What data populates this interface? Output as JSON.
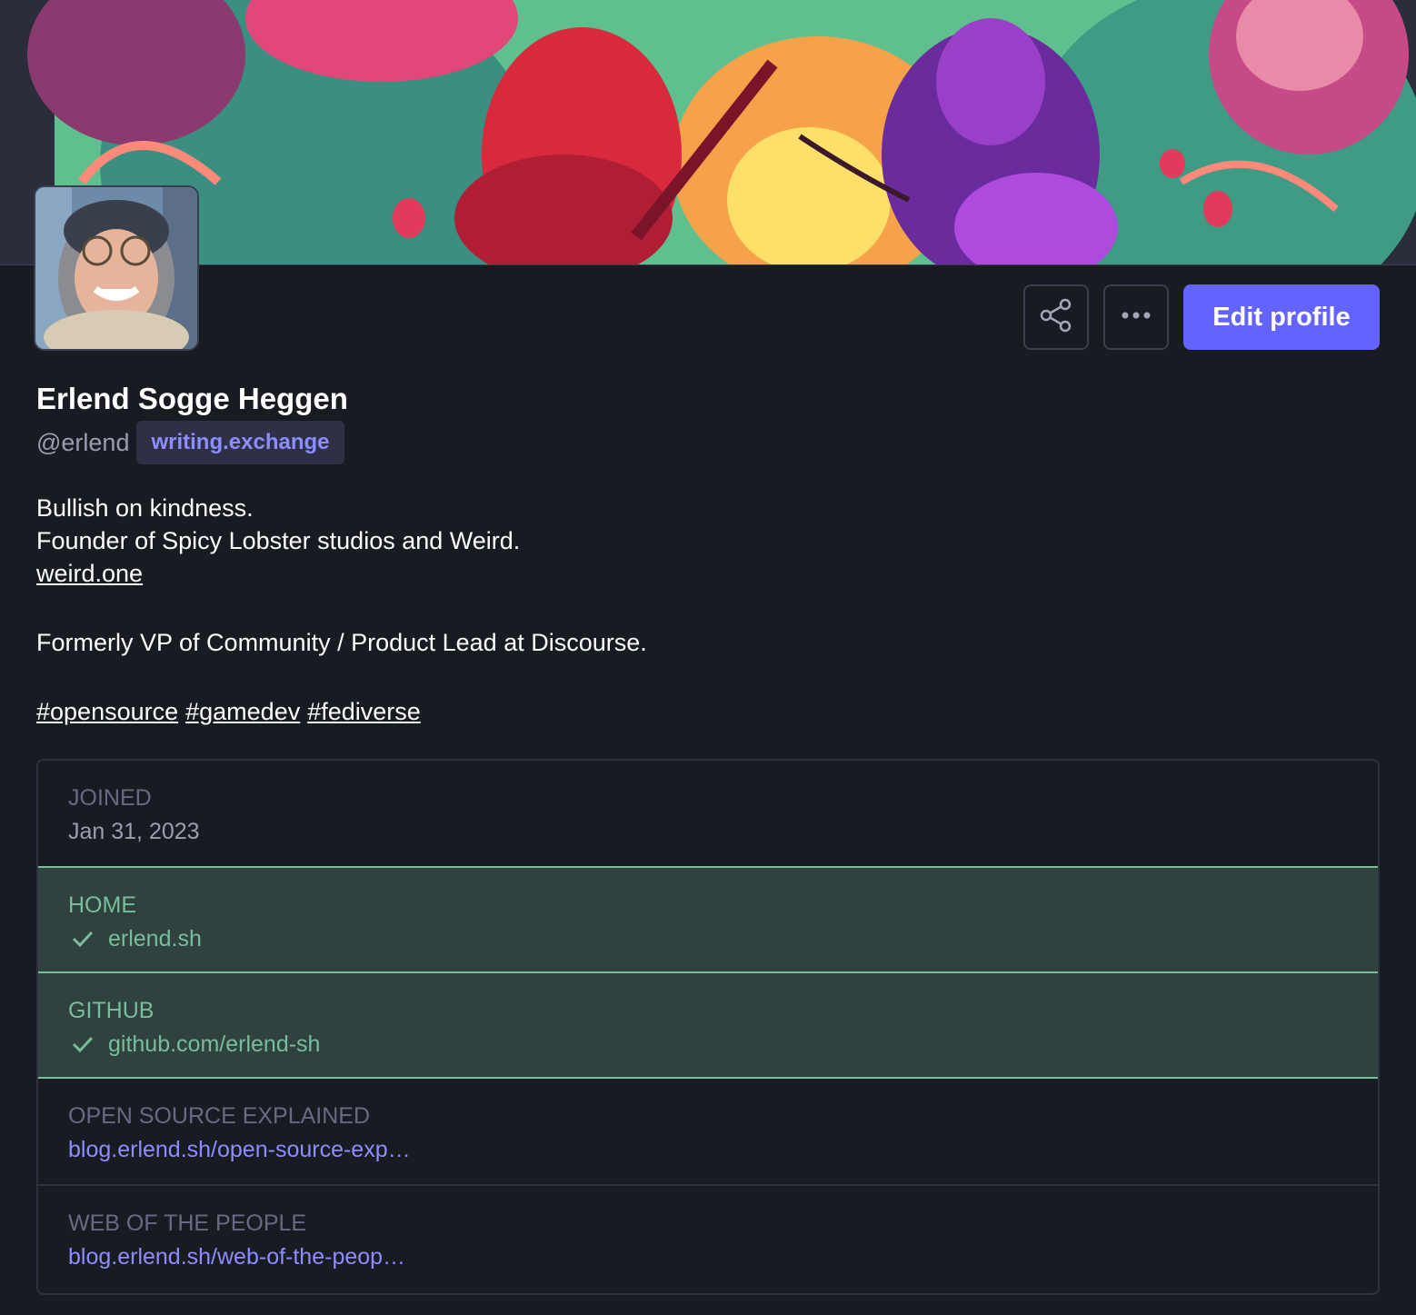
{
  "profile": {
    "display_name": "Erlend Sogge Heggen",
    "handle": "@erlend",
    "domain": "writing.exchange"
  },
  "actions": {
    "share_icon": "share-icon",
    "more_icon": "more-horizontal-icon",
    "edit_label": "Edit profile"
  },
  "bio": {
    "line1": "Bullish on kindness.",
    "line2": "Founder of Spicy Lobster studios and Weird.",
    "link": "weird.one",
    "line3": "Formerly VP of Community / Product Lead at Discourse.",
    "tags": [
      "#opensource",
      "#gamedev",
      "#fediverse"
    ]
  },
  "fields": [
    {
      "label": "JOINED",
      "value": "Jan 31, 2023"
    },
    {
      "label": "HOME",
      "value": "erlend.sh",
      "verified": true
    },
    {
      "label": "GITHUB",
      "value": "github.com/erlend-sh",
      "verified": true
    },
    {
      "label": "OPEN SOURCE EXPLAINED",
      "value": "blog.erlend.sh/open-source-exp…"
    },
    {
      "label": "WEB OF THE PEOPLE",
      "value": "blog.erlend.sh/web-of-the-peop…"
    }
  ],
  "colors": {
    "background": "#191b22",
    "accent": "#6364ff",
    "link": "#8c8dff",
    "verified": "#79bd9a",
    "verified_bg": "#2f4240"
  }
}
